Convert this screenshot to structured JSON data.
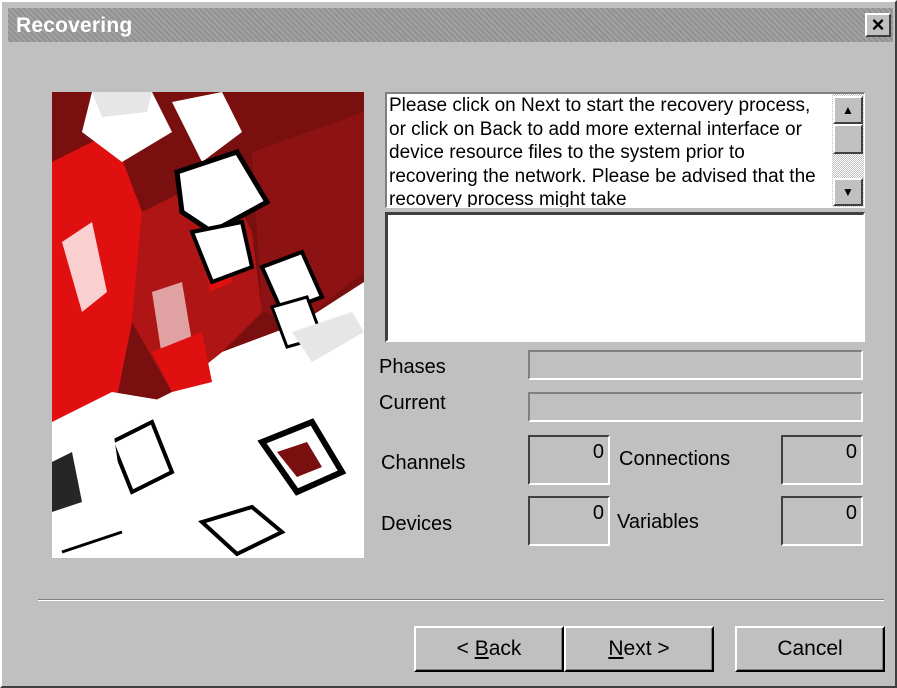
{
  "window": {
    "title": "Recovering",
    "close_label": "×"
  },
  "message": {
    "text": "Please click on Next to start the recovery process, or click on Back to add more external interface or device resource files to the system prior to recovering the network. Please be advised that the recovery process might take"
  },
  "scrollbar": {
    "up_glyph": "▲",
    "down_glyph": "▼"
  },
  "progress": {
    "phases_label": "Phases",
    "current_label": "Current"
  },
  "counters": {
    "channels_label": "Channels",
    "channels_value": "0",
    "connections_label": "Connections",
    "connections_value": "0",
    "devices_label": "Devices",
    "devices_value": "0",
    "variables_label": "Variables",
    "variables_value": "0"
  },
  "buttons": {
    "back_prefix": "< ",
    "back_mnemonic": "B",
    "back_rest": "ack",
    "next_mnemonic": "N",
    "next_rest": "ext >",
    "cancel_label": "Cancel"
  },
  "colors": {
    "face": "#c0c0c0",
    "title_bg": "#9a9a9a",
    "accent_red": "#e01010",
    "dark_red": "#7a0f10"
  }
}
